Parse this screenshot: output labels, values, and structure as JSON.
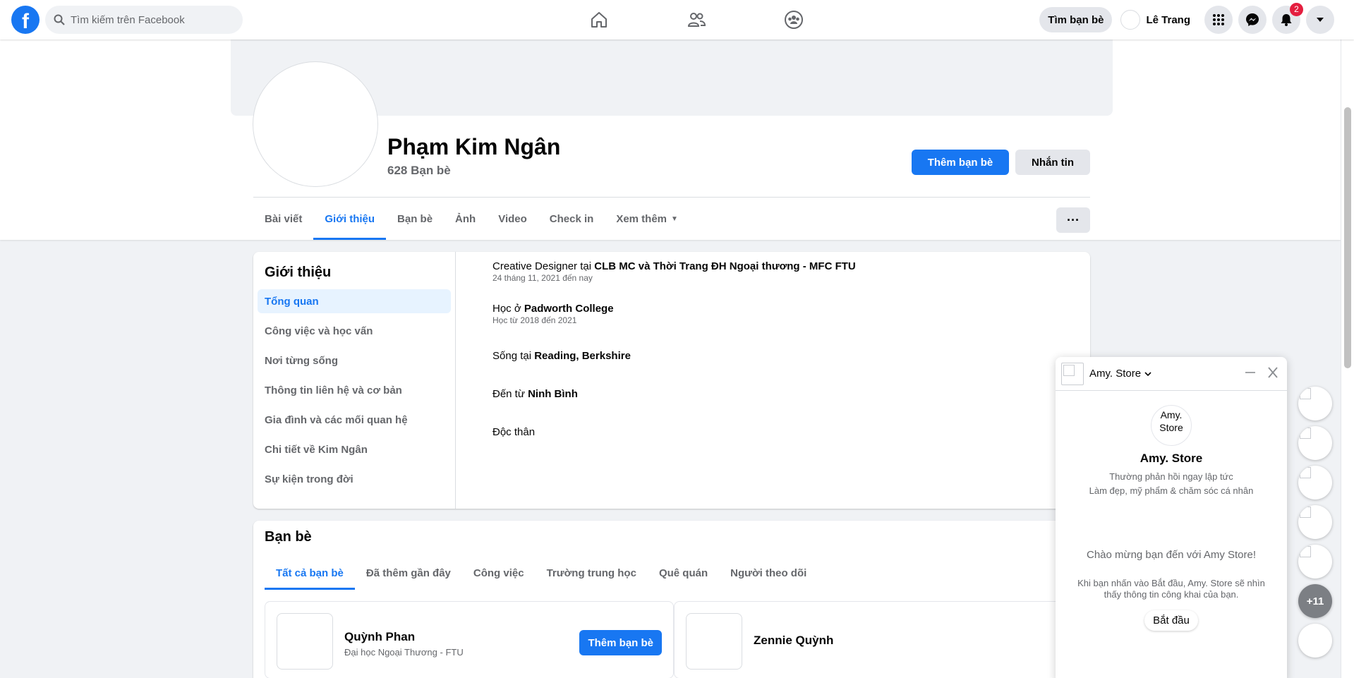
{
  "topbar": {
    "logo_letter": "f",
    "search_placeholder": "Tìm kiếm trên Facebook",
    "find_friends_label": "Tìm bạn bè",
    "user_name": "Lê Trang",
    "notifications_count": "2"
  },
  "profile": {
    "name": "Phạm Kim Ngân",
    "friends_count": "628 Bạn bè",
    "add_friend_label": "Thêm bạn bè",
    "message_label": "Nhắn tin",
    "more_label": "···",
    "tabs": [
      {
        "label": "Bài viết"
      },
      {
        "label": "Giới thiệu"
      },
      {
        "label": "Bạn bè"
      },
      {
        "label": "Ảnh"
      },
      {
        "label": "Video"
      },
      {
        "label": "Check in"
      },
      {
        "label": "Xem thêm"
      }
    ]
  },
  "intro": {
    "title": "Giới thiệu",
    "nav": [
      {
        "label": "Tổng quan"
      },
      {
        "label": "Công việc và học vấn"
      },
      {
        "label": "Nơi từng sống"
      },
      {
        "label": "Thông tin liên hệ và cơ bản"
      },
      {
        "label": "Gia đình và các mối quan hệ"
      },
      {
        "label": "Chi tiết về Kim Ngân"
      },
      {
        "label": "Sự kiện trong đời"
      }
    ],
    "items": [
      {
        "prefix": "Creative Designer tại ",
        "bold": "CLB MC và Thời Trang ĐH Ngoại thương - MFC FTU",
        "sub": "24 tháng 11, 2021 đến nay"
      },
      {
        "prefix": "Học ở ",
        "bold": "Padworth College",
        "sub": "Học từ 2018 đến 2021"
      },
      {
        "prefix": "Sống tại ",
        "bold": "Reading, Berkshire",
        "sub": ""
      },
      {
        "prefix": "Đến từ ",
        "bold": "Ninh Bình",
        "sub": ""
      },
      {
        "prefix": "Độc thân",
        "bold": "",
        "sub": ""
      }
    ]
  },
  "friends": {
    "title": "Bạn bè",
    "tabs": [
      {
        "label": "Tất cả bạn bè"
      },
      {
        "label": "Đã thêm gần đây"
      },
      {
        "label": "Công việc"
      },
      {
        "label": "Trường trung học"
      },
      {
        "label": "Quê quán"
      },
      {
        "label": "Người theo dõi"
      }
    ],
    "list": [
      {
        "name": "Quỳnh Phan",
        "sub": "Đại học Ngoại Thương - FTU",
        "button": "Thêm bạn bè"
      },
      {
        "name": "Zennie Quỳnh",
        "sub": "",
        "button": ""
      }
    ]
  },
  "chat": {
    "page_name": "Amy. Store",
    "avatar_alt": "Amy. Store",
    "response": "Thường phản hồi ngay lập tức",
    "category": "Làm đẹp, mỹ phẩm & chăm sóc cá nhân",
    "welcome": "Chào mừng bạn đến với Amy Store!",
    "note": "Khi bạn nhấn vào Bắt đầu, Amy. Store sẽ nhìn thấy thông tin công khai của bạn.",
    "start_label": "Bắt đầu"
  },
  "chat_heads": {
    "more_label": "+11"
  },
  "colors": {
    "accent": "#1877f2",
    "badge": "#e41e3f"
  }
}
